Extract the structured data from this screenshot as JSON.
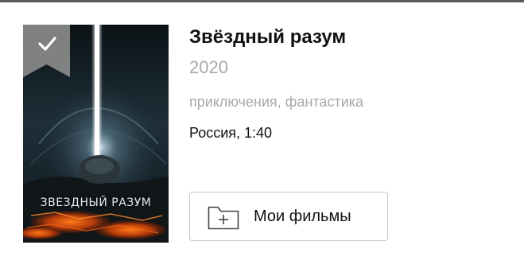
{
  "movie": {
    "title": "Звёздный разум",
    "year": "2020",
    "genres": "приключения, фантастика",
    "meta": "Россия, 1:40",
    "poster_title": "ЗВЕЗДНЫЙ РАЗУМ"
  },
  "actions": {
    "my_movies_label": "Мои фильмы",
    "my_movies_icon": "folder-plus-icon"
  },
  "badge": {
    "icon": "checkmark-icon",
    "state": "watched"
  },
  "colors": {
    "title_text": "#111111",
    "muted_text": "#a8a8a8",
    "button_border": "#c9c9c9",
    "badge_bg": "#8a8a8a"
  }
}
